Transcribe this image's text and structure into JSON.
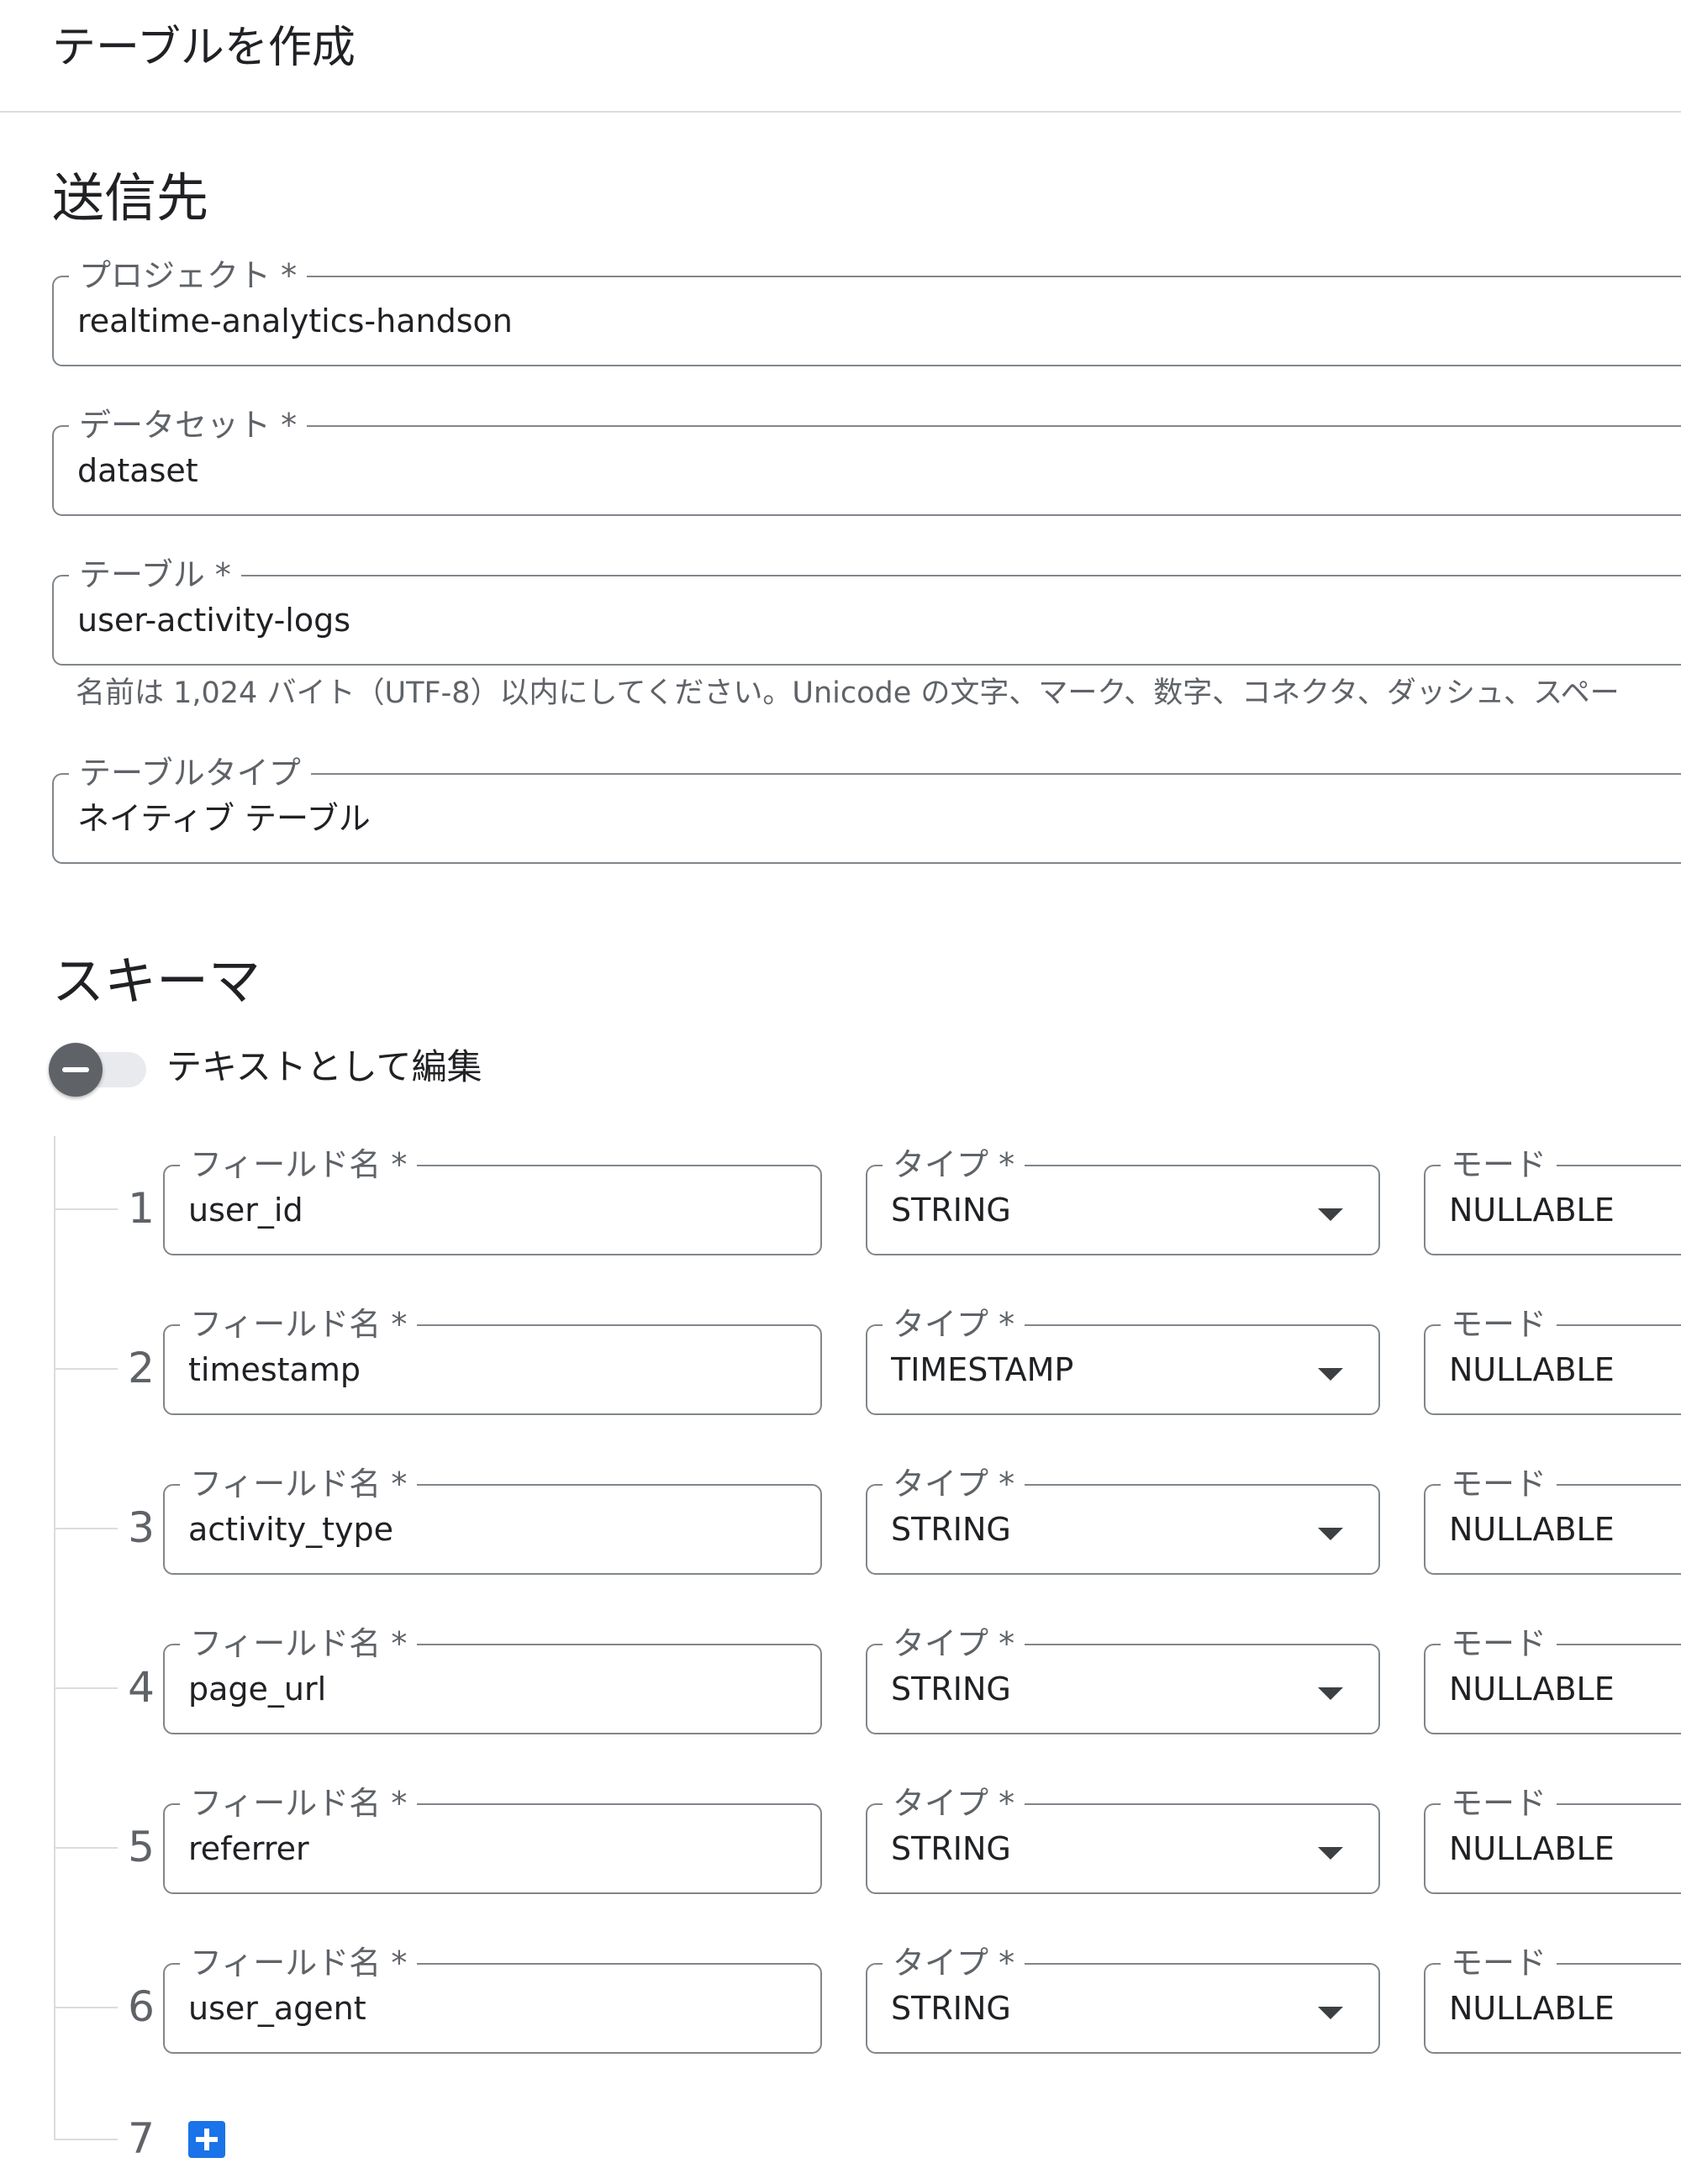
{
  "page_title": "テーブルを作成",
  "destination": {
    "heading": "送信先",
    "project": {
      "label": "プロジェクト *",
      "value": "realtime-analytics-handson"
    },
    "dataset": {
      "label": "データセット *",
      "value": "dataset"
    },
    "table": {
      "label": "テーブル *",
      "value": "user-activity-logs"
    },
    "table_hint": "名前は 1,024 バイト（UTF-8）以内にしてください。Unicode の文字、マーク、数字、コネクタ、ダッシュ、スペー",
    "table_type": {
      "label": "テーブルタイプ",
      "value": "ネイティブ テーブル"
    }
  },
  "schema": {
    "heading": "スキーマ",
    "edit_as_text_label": "テキストとして編集",
    "field_name_label": "フィールド名 *",
    "type_label": "タイプ *",
    "mode_label": "モード",
    "rows": [
      {
        "num": "1",
        "name": "user_id",
        "type": "STRING",
        "mode": "NULLABLE"
      },
      {
        "num": "2",
        "name": "timestamp",
        "type": "TIMESTAMP",
        "mode": "NULLABLE"
      },
      {
        "num": "3",
        "name": "activity_type",
        "type": "STRING",
        "mode": "NULLABLE"
      },
      {
        "num": "4",
        "name": "page_url",
        "type": "STRING",
        "mode": "NULLABLE"
      },
      {
        "num": "5",
        "name": "referrer",
        "type": "STRING",
        "mode": "NULLABLE"
      },
      {
        "num": "6",
        "name": "user_agent",
        "type": "STRING",
        "mode": "NULLABLE"
      }
    ],
    "next_row_num": "7",
    "add_field_icon": "plus-icon"
  },
  "colors": {
    "accent": "#1a73e8",
    "outline": "#80868b",
    "label": "#5f6368"
  }
}
